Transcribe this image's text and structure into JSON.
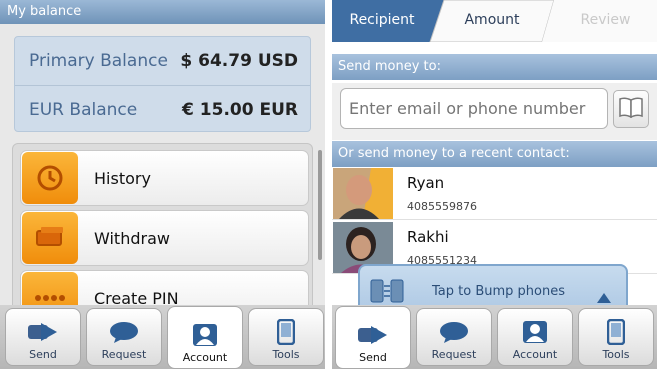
{
  "left": {
    "header": "My balance",
    "balances": [
      {
        "label": "Primary Balance",
        "value": "$ 64.79 USD"
      },
      {
        "label": "EUR Balance",
        "value": "€ 15.00 EUR"
      }
    ],
    "menu": [
      {
        "label": "History",
        "icon": "history-clock-icon"
      },
      {
        "label": "Withdraw",
        "icon": "withdraw-cash-icon"
      },
      {
        "label": "Create PIN",
        "icon": "pin-dots-icon"
      }
    ],
    "tabs": [
      {
        "label": "Send",
        "icon": "send-arrow-icon"
      },
      {
        "label": "Request",
        "icon": "request-bubble-icon"
      },
      {
        "label": "Account",
        "icon": "account-person-icon",
        "active": true
      },
      {
        "label": "Tools",
        "icon": "phone-tools-icon"
      }
    ]
  },
  "right": {
    "wizard": [
      {
        "label": "Recipient",
        "state": "active"
      },
      {
        "label": "Amount",
        "state": "normal"
      },
      {
        "label": "Review",
        "state": "disabled"
      }
    ],
    "send_to_header": "Send money to:",
    "input_placeholder": "Enter email or phone number",
    "recent_header": "Or send money to a recent contact:",
    "contacts": [
      {
        "name": "Ryan",
        "number": "4085559876"
      },
      {
        "name": "Rakhi",
        "number": "4085551234"
      }
    ],
    "bump_label": "Tap to Bump phones",
    "tabs": [
      {
        "label": "Send",
        "icon": "send-arrow-icon",
        "active": true
      },
      {
        "label": "Request",
        "icon": "request-bubble-icon"
      },
      {
        "label": "Account",
        "icon": "account-person-icon"
      },
      {
        "label": "Tools",
        "icon": "phone-tools-icon"
      }
    ]
  },
  "colors": {
    "header_blue": "#7d9fc4",
    "accent_blue": "#2f5f96",
    "menu_orange": "#f5a020"
  }
}
